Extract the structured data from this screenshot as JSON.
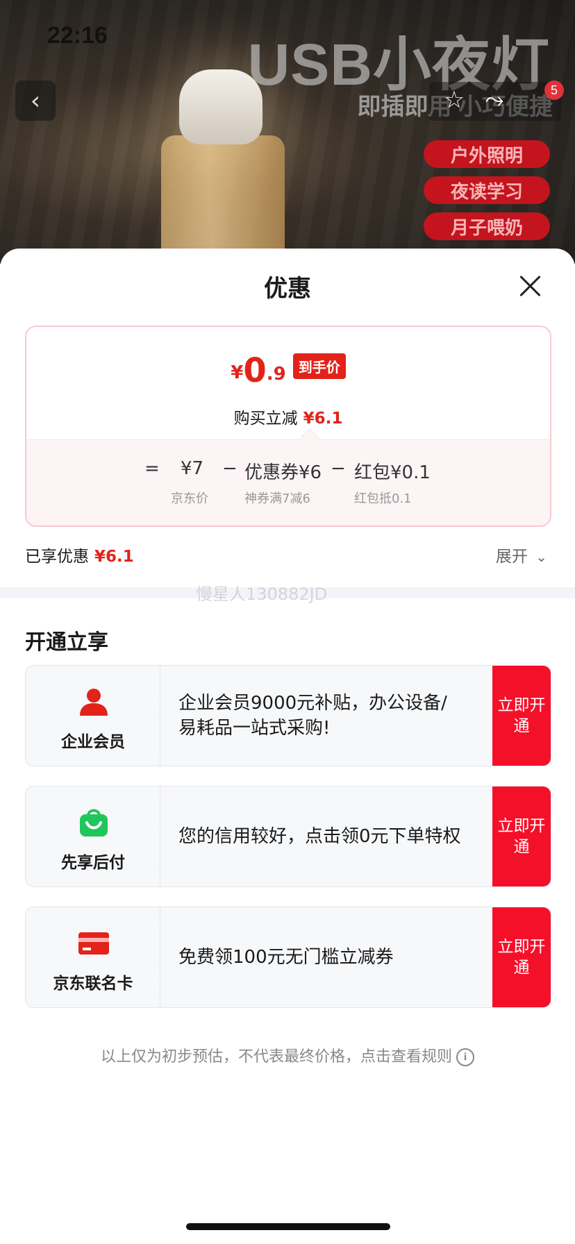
{
  "status_bar": {
    "time": "22:16"
  },
  "product_banner": {
    "title": "USB小夜灯",
    "subtitle": "即插即用 小巧便捷",
    "tags": [
      "户外照明",
      "夜读学习",
      "月子喂奶"
    ],
    "cart_badge": "5"
  },
  "sheet": {
    "title": "优惠",
    "price": {
      "yen": "¥",
      "integer": "0",
      "decimal": ".9",
      "final_tag": "到手价",
      "reduce_label": "购买立减",
      "reduce_value": "¥6.1"
    },
    "formula": {
      "equals": "=",
      "jd_price": "¥7",
      "minus1": "−",
      "coupon": "优惠券¥6",
      "minus2": "−",
      "redpacket": "红包¥0.1",
      "jd_price_label": "京东价",
      "coupon_label": "神券满7减6",
      "redpacket_label": "红包抵0.1"
    },
    "enjoyed_label": "已享优惠",
    "enjoyed_value": "¥6.1",
    "expand_label": "展开",
    "watermark": "慢星人130882JD",
    "section_title": "开通立享",
    "services": [
      {
        "name": "企业会员",
        "icon": "person-icon",
        "desc": "企业会员9000元补贴，办公设备/易耗品一站式采购!",
        "button": "立即开通"
      },
      {
        "name": "先享后付",
        "icon": "shopping-bag-icon",
        "desc": "您的信用较好，点击领0元下单特权",
        "button": "立即开通"
      },
      {
        "name": "京东联名卡",
        "icon": "credit-card-icon",
        "desc": "免费领100元无门槛立减券",
        "button": "立即开通"
      }
    ],
    "disclaimer": "以上仅为初步预估，不代表最终价格，点击查看规则"
  },
  "colors": {
    "accent_red": "#e2231a",
    "button_red": "#f5102a",
    "green": "#21c55d"
  }
}
